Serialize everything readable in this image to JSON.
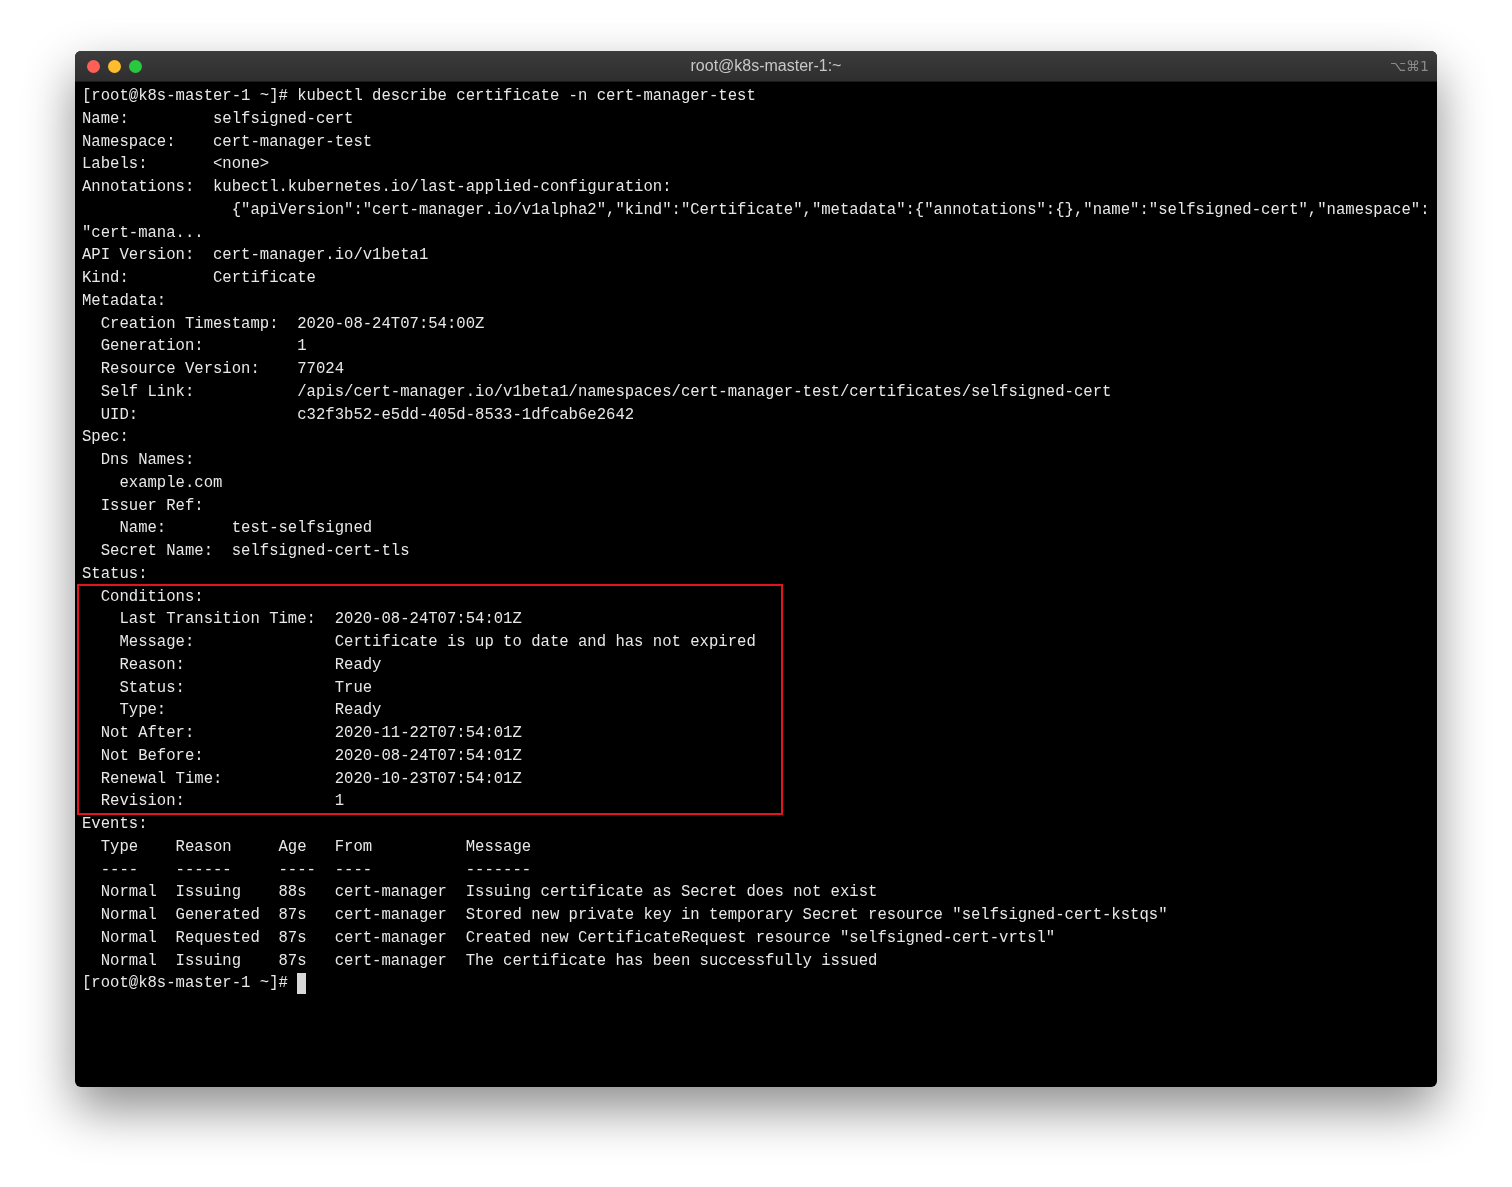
{
  "window": {
    "title": "root@k8s-master-1:~",
    "shortcut": "⌥⌘1"
  },
  "terminal": {
    "cursor": true,
    "blocks": [
      {
        "highlighted": false,
        "lines": [
          "[root@k8s-master-1 ~]# kubectl describe certificate -n cert-manager-test",
          "Name:         selfsigned-cert",
          "Namespace:    cert-manager-test",
          "Labels:       <none>",
          "Annotations:  kubectl.kubernetes.io/last-applied-configuration:",
          "                {\"apiVersion\":\"cert-manager.io/v1alpha2\",\"kind\":\"Certificate\",\"metadata\":{\"annotations\":{},\"name\":\"selfsigned-cert\",\"namespace\":",
          "\"cert-mana...",
          "API Version:  cert-manager.io/v1beta1",
          "Kind:         Certificate",
          "Metadata:",
          "  Creation Timestamp:  2020-08-24T07:54:00Z",
          "  Generation:          1",
          "  Resource Version:    77024",
          "  Self Link:           /apis/cert-manager.io/v1beta1/namespaces/cert-manager-test/certificates/selfsigned-cert",
          "  UID:                 c32f3b52-e5dd-405d-8533-1dfcab6e2642",
          "Spec:",
          "  Dns Names:",
          "    example.com",
          "  Issuer Ref:",
          "    Name:       test-selfsigned",
          "  Secret Name:  selfsigned-cert-tls",
          "Status:"
        ]
      },
      {
        "highlighted": true,
        "lines": [
          "  Conditions:",
          "    Last Transition Time:  2020-08-24T07:54:01Z",
          "    Message:               Certificate is up to date and has not expired",
          "    Reason:                Ready",
          "    Status:                True",
          "    Type:                  Ready",
          "  Not After:               2020-11-22T07:54:01Z",
          "  Not Before:              2020-08-24T07:54:01Z",
          "  Renewal Time:            2020-10-23T07:54:01Z",
          "  Revision:                1"
        ]
      },
      {
        "highlighted": false,
        "lines": [
          "Events:",
          "  Type    Reason     Age   From          Message",
          "  ----    ------     ----  ----          -------",
          "  Normal  Issuing    88s   cert-manager  Issuing certificate as Secret does not exist",
          "  Normal  Generated  87s   cert-manager  Stored new private key in temporary Secret resource \"selfsigned-cert-kstqs\"",
          "  Normal  Requested  87s   cert-manager  Created new CertificateRequest resource \"selfsigned-cert-vrtsl\"",
          "  Normal  Issuing    87s   cert-manager  The certificate has been successfully issued",
          "[root@k8s-master-1 ~]# "
        ]
      }
    ]
  }
}
